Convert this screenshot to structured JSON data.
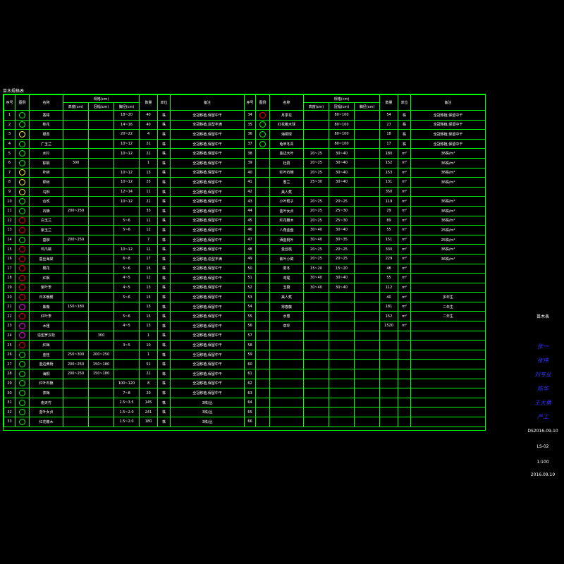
{
  "title": "苗木规格表",
  "header": {
    "no": "序号",
    "icon": "图例",
    "name": "名称",
    "spec": "规格(cm)",
    "height": "高度(cm)",
    "crown": "冠幅(cm)",
    "dbh": "胸径(cm)",
    "qty": "数量",
    "unit": "单位",
    "note": "备注"
  },
  "colors": {
    "grid": "#00ff00",
    "text": "#ffffff",
    "signature": "#3333ff"
  },
  "left_rows": [
    {
      "no": "1",
      "name": "香樟",
      "h": "",
      "c": "",
      "d": "18~20",
      "q": "40",
      "u": "株",
      "n": "全冠移植,保留中干",
      "color": "#00ff00"
    },
    {
      "no": "2",
      "name": "桂花",
      "h": "",
      "c": "",
      "d": "14~16",
      "q": "40",
      "u": "株",
      "n": "全冠移植,造型丰满",
      "color": "#00ff00"
    },
    {
      "no": "3",
      "name": "银杏",
      "h": "",
      "c": "",
      "d": "20~22",
      "q": "4",
      "u": "株",
      "n": "全冠移植,保留中干",
      "color": "#ffff00"
    },
    {
      "no": "4",
      "name": "广玉兰",
      "h": "",
      "c": "",
      "d": "10~12",
      "q": "21",
      "u": "株",
      "n": "全冠移植,保留中干",
      "color": "#00ff00"
    },
    {
      "no": "5",
      "name": "水杉",
      "h": "",
      "c": "",
      "d": "10~12",
      "q": "21",
      "u": "株",
      "n": "全冠移植,保留中干",
      "color": "#00ff00"
    },
    {
      "no": "6",
      "name": "棕榈",
      "h": "300",
      "c": "",
      "d": "",
      "q": "1",
      "u": "株",
      "n": "全冠移植,保留中干",
      "color": "#00ff00"
    },
    {
      "no": "7",
      "name": "朴树",
      "h": "",
      "c": "",
      "d": "10~12",
      "q": "13",
      "u": "株",
      "n": "全冠移植,保留中干",
      "color": "#ffff00"
    },
    {
      "no": "8",
      "name": "榉树",
      "h": "",
      "c": "",
      "d": "10~12",
      "q": "25",
      "u": "株",
      "n": "全冠移植,保留中干",
      "color": "#ffff00"
    },
    {
      "no": "9",
      "name": "乌桕",
      "h": "",
      "c": "",
      "d": "12~14",
      "q": "11",
      "u": "株",
      "n": "全冠移植,保留中干",
      "color": "#ffff00"
    },
    {
      "no": "10",
      "name": "合欢",
      "h": "",
      "c": "",
      "d": "10~12",
      "q": "21",
      "u": "株",
      "n": "全冠移植,保留中干",
      "color": "#00ff00"
    },
    {
      "no": "11",
      "name": "石楠",
      "h": "200~250",
      "c": "",
      "d": "",
      "q": "33",
      "u": "株",
      "n": "全冠移植,保留中干",
      "color": "#00ff00"
    },
    {
      "no": "12",
      "name": "白玉兰",
      "h": "",
      "c": "",
      "d": "5~6",
      "q": "11",
      "u": "株",
      "n": "全冠移植,保留中干",
      "color": "#ff0000"
    },
    {
      "no": "13",
      "name": "紫玉兰",
      "h": "",
      "c": "",
      "d": "5~6",
      "q": "12",
      "u": "株",
      "n": "全冠移植,保留中干",
      "color": "#ff0000"
    },
    {
      "no": "14",
      "name": "垂柳",
      "h": "200~250",
      "c": "",
      "d": "",
      "q": "7",
      "u": "株",
      "n": "全冠移植,保留中干",
      "color": "#00ff00"
    },
    {
      "no": "15",
      "name": "鸡爪槭",
      "h": "",
      "c": "",
      "d": "10~12",
      "q": "11",
      "u": "株",
      "n": "全冠移植,保留中干",
      "color": "#ff0000"
    },
    {
      "no": "16",
      "name": "垂丝海棠",
      "h": "",
      "c": "",
      "d": "6~8",
      "q": "17",
      "u": "株",
      "n": "全冠移植,造型丰满",
      "color": "#ff0000"
    },
    {
      "no": "17",
      "name": "樱花",
      "h": "",
      "c": "",
      "d": "5~6",
      "q": "15",
      "u": "株",
      "n": "全冠移植,保留中干",
      "color": "#ff0000"
    },
    {
      "no": "18",
      "name": "红枫",
      "h": "",
      "c": "",
      "d": "4~5",
      "q": "12",
      "u": "株",
      "n": "全冠移植,保留中干",
      "color": "#ff0000"
    },
    {
      "no": "19",
      "name": "紫叶李",
      "h": "",
      "c": "",
      "d": "4~5",
      "q": "13",
      "u": "株",
      "n": "全冠移植,保留中干",
      "color": "#ff0000"
    },
    {
      "no": "20",
      "name": "日本晚樱",
      "h": "",
      "c": "",
      "d": "5~6",
      "q": "15",
      "u": "株",
      "n": "全冠移植,保留中干",
      "color": "#ff0000"
    },
    {
      "no": "21",
      "name": "紫薇",
      "h": "150~180",
      "c": "",
      "d": "",
      "q": "13",
      "u": "株",
      "n": "全冠移植,保留中干",
      "color": "#ff00ff"
    },
    {
      "no": "22",
      "name": "红叶李",
      "h": "",
      "c": "",
      "d": "5~6",
      "q": "15",
      "u": "株",
      "n": "全冠移植,保留中干",
      "color": "#ff0000"
    },
    {
      "no": "23",
      "name": "木槿",
      "h": "",
      "c": "",
      "d": "4~5",
      "q": "13",
      "u": "株",
      "n": "全冠移植,保留中干",
      "color": "#ff00ff"
    },
    {
      "no": "24",
      "name": "造型罗汉松",
      "h": "",
      "c": "300",
      "d": "",
      "q": "1",
      "u": "株",
      "n": "全冠移植,保留中干",
      "color": "#ff00ff"
    },
    {
      "no": "25",
      "name": "红梅",
      "h": "",
      "c": "",
      "d": "3~5",
      "q": "10",
      "u": "株",
      "n": "全冠移植,保留中干",
      "color": "#ff0000"
    },
    {
      "no": "26",
      "name": "金桂",
      "h": "250~300",
      "c": "200~250",
      "d": "",
      "q": "1",
      "u": "株",
      "n": "全冠移植,保留中干",
      "color": "#00ff00"
    },
    {
      "no": "27",
      "name": "金边黄杨",
      "h": "200~250",
      "c": "150~180",
      "d": "",
      "q": "51",
      "u": "株",
      "n": "全冠移植,保留中干",
      "color": "#00ff00"
    },
    {
      "no": "28",
      "name": "海桐",
      "h": "200~250",
      "c": "150~180",
      "d": "",
      "q": "21",
      "u": "株",
      "n": "全冠移植,保留中干",
      "color": "#00ff00"
    },
    {
      "no": "29",
      "name": "红叶石楠",
      "h": "",
      "c": "",
      "d": "100~120",
      "q": "8",
      "u": "株",
      "n": "全冠移植,保留中干",
      "color": "#00ff00"
    },
    {
      "no": "30",
      "name": "茶梅",
      "h": "",
      "c": "",
      "d": "7~8",
      "q": "20",
      "u": "株",
      "n": "全冠移植,保留中干",
      "color": "#00ff00"
    },
    {
      "no": "31",
      "name": "南天竹",
      "h": "",
      "c": "",
      "d": "2.5~3.5",
      "q": "145",
      "u": "株",
      "n": "3株/丛",
      "color": "#00ff00"
    },
    {
      "no": "32",
      "name": "金叶女贞",
      "h": "",
      "c": "",
      "d": "1.5~2.0",
      "q": "241",
      "u": "株",
      "n": "3株/丛",
      "color": "#00ff00"
    },
    {
      "no": "33",
      "name": "红花檵木",
      "h": "",
      "c": "",
      "d": "1.5~2.0",
      "q": "180",
      "u": "株",
      "n": "3株/丛",
      "color": "#00ff00"
    }
  ],
  "right_rows": [
    {
      "no": "34",
      "name": "月季花",
      "h": "",
      "c": "80~100",
      "d": "",
      "q": "54",
      "u": "株",
      "n": "全冠移植,保留中干",
      "color": "#ff0000"
    },
    {
      "no": "35",
      "name": "红花檵木球",
      "h": "",
      "c": "80~100",
      "d": "",
      "q": "27",
      "u": "株",
      "n": "全冠移植,保留中干",
      "color": "#00ff00"
    },
    {
      "no": "36",
      "name": "海桐球",
      "h": "",
      "c": "80~100",
      "d": "",
      "q": "18",
      "u": "株",
      "n": "全冠移植,保留中干",
      "color": "#00ff00"
    },
    {
      "no": "37",
      "name": "龟甲冬青",
      "h": "",
      "c": "80~100",
      "d": "",
      "q": "17",
      "u": "株",
      "n": "全冠移植,保留中干",
      "color": "#00ff00"
    },
    {
      "no": "38",
      "name": "金边大叶",
      "h": "20~25",
      "c": "30~40",
      "d": "",
      "q": "180",
      "u": "m²",
      "n": "36株/m²",
      "color": ""
    },
    {
      "no": "39",
      "name": "杜鹃",
      "h": "20~25",
      "c": "30~40",
      "d": "",
      "q": "152",
      "u": "m²",
      "n": "36株/m²",
      "color": ""
    },
    {
      "no": "40",
      "name": "红叶石楠",
      "h": "20~25",
      "c": "30~40",
      "d": "",
      "q": "153",
      "u": "m²",
      "n": "36株/m²",
      "color": ""
    },
    {
      "no": "41",
      "name": "葱兰",
      "h": "25~30",
      "c": "30~40",
      "d": "",
      "q": "131",
      "u": "m²",
      "n": "36株/m²",
      "color": ""
    },
    {
      "no": "42",
      "name": "美人蕉",
      "h": "",
      "c": "",
      "d": "",
      "q": "350",
      "u": "m²",
      "n": "",
      "color": ""
    },
    {
      "no": "43",
      "name": "小叶栀子",
      "h": "20~25",
      "c": "20~25",
      "d": "",
      "q": "119",
      "u": "m²",
      "n": "36株/m²",
      "color": ""
    },
    {
      "no": "44",
      "name": "金叶女贞",
      "h": "20~25",
      "c": "25~30",
      "d": "",
      "q": "29",
      "u": "m²",
      "n": "36株/m²",
      "color": ""
    },
    {
      "no": "45",
      "name": "红花檵木",
      "h": "20~25",
      "c": "25~30",
      "d": "",
      "q": "89",
      "u": "m²",
      "n": "36株/m²",
      "color": ""
    },
    {
      "no": "46",
      "name": "八角金盘",
      "h": "30~40",
      "c": "30~40",
      "d": "",
      "q": "55",
      "u": "m²",
      "n": "25株/m²",
      "color": ""
    },
    {
      "no": "47",
      "name": "洒金桃叶",
      "h": "30~40",
      "c": "30~35",
      "d": "",
      "q": "151",
      "u": "m²",
      "n": "25株/m²",
      "color": ""
    },
    {
      "no": "48",
      "name": "金丝桃",
      "h": "20~25",
      "c": "20~25",
      "d": "",
      "q": "330",
      "u": "m²",
      "n": "36株/m²",
      "color": ""
    },
    {
      "no": "49",
      "name": "紫叶小檗",
      "h": "20~25",
      "c": "20~25",
      "d": "",
      "q": "229",
      "u": "m²",
      "n": "36株/m²",
      "color": ""
    },
    {
      "no": "50",
      "name": "麦冬",
      "h": "15~20",
      "c": "15~20",
      "d": "",
      "q": "48",
      "u": "m²",
      "n": "",
      "color": ""
    },
    {
      "no": "51",
      "name": "鸢尾",
      "h": "30~40",
      "c": "30~40",
      "d": "",
      "q": "55",
      "u": "m²",
      "n": "",
      "color": ""
    },
    {
      "no": "52",
      "name": "玉簪",
      "h": "30~40",
      "c": "30~40",
      "d": "",
      "q": "112",
      "u": "m²",
      "n": "",
      "color": ""
    },
    {
      "no": "53",
      "name": "美人蕉",
      "h": "",
      "c": "",
      "d": "",
      "q": "40",
      "u": "m²",
      "n": "多年生",
      "color": ""
    },
    {
      "no": "54",
      "name": "常春藤",
      "h": "",
      "c": "",
      "d": "",
      "q": "181",
      "u": "m²",
      "n": "二年生",
      "color": ""
    },
    {
      "no": "55",
      "name": "水葱",
      "h": "",
      "c": "",
      "d": "",
      "q": "152",
      "u": "m²",
      "n": "二年生",
      "color": ""
    },
    {
      "no": "56",
      "name": "草坪",
      "h": "",
      "c": "",
      "d": "",
      "q": "1520",
      "u": "m²",
      "n": "",
      "color": ""
    },
    {
      "no": "57",
      "name": "",
      "h": "",
      "c": "",
      "d": "",
      "q": "",
      "u": "",
      "n": "",
      "color": ""
    },
    {
      "no": "58",
      "name": "",
      "h": "",
      "c": "",
      "d": "",
      "q": "",
      "u": "",
      "n": "",
      "color": ""
    },
    {
      "no": "59",
      "name": "",
      "h": "",
      "c": "",
      "d": "",
      "q": "",
      "u": "",
      "n": "",
      "color": ""
    },
    {
      "no": "60",
      "name": "",
      "h": "",
      "c": "",
      "d": "",
      "q": "",
      "u": "",
      "n": "",
      "color": ""
    },
    {
      "no": "61",
      "name": "",
      "h": "",
      "c": "",
      "d": "",
      "q": "",
      "u": "",
      "n": "",
      "color": ""
    },
    {
      "no": "62",
      "name": "",
      "h": "",
      "c": "",
      "d": "",
      "q": "",
      "u": "",
      "n": "",
      "color": ""
    },
    {
      "no": "63",
      "name": "",
      "h": "",
      "c": "",
      "d": "",
      "q": "",
      "u": "",
      "n": "",
      "color": ""
    },
    {
      "no": "64",
      "name": "",
      "h": "",
      "c": "",
      "d": "",
      "q": "",
      "u": "",
      "n": "",
      "color": ""
    },
    {
      "no": "65",
      "name": "",
      "h": "",
      "c": "",
      "d": "",
      "q": "",
      "u": "",
      "n": "",
      "color": ""
    },
    {
      "no": "66",
      "name": "",
      "h": "",
      "c": "",
      "d": "",
      "q": "",
      "u": "",
      "n": "",
      "color": ""
    }
  ],
  "title_block": {
    "label": "苗木表",
    "signatures": [
      "张一",
      "张伟",
      "刘专业",
      "陈华",
      "王大勇",
      "严工"
    ],
    "drawing_no": "DS2016-09-10",
    "sheet": "LS-02",
    "scale": "1:100",
    "date": "2016.09.10"
  }
}
